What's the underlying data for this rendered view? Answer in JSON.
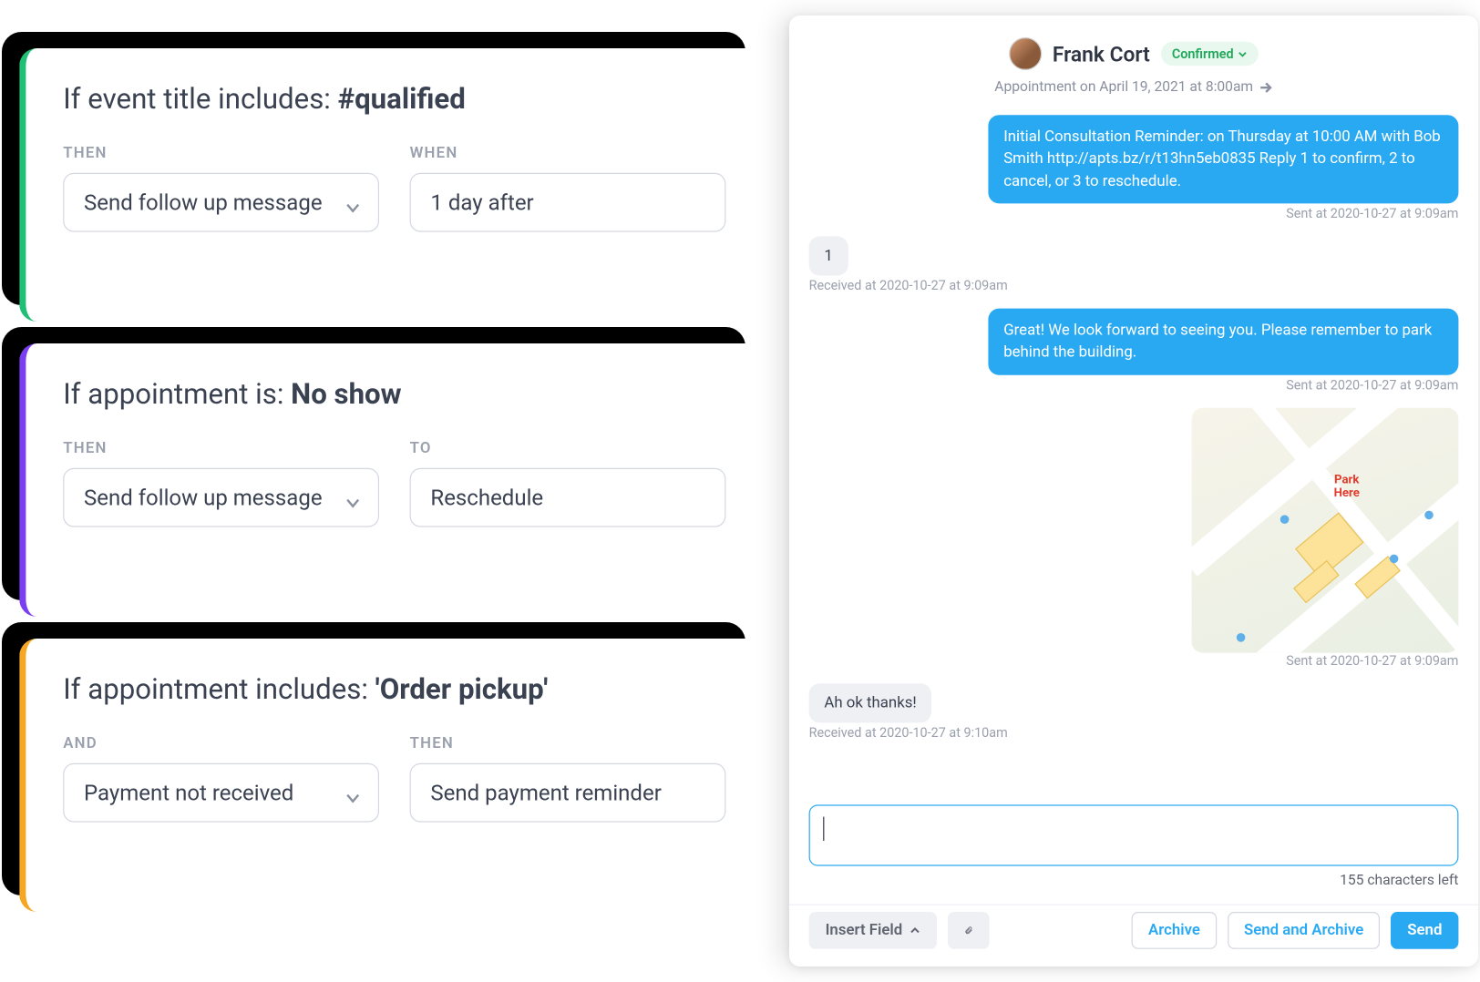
{
  "rules": [
    {
      "title_prefix": "If event title includes: ",
      "title_bold": "#qualified",
      "label1": "THEN",
      "value1": "Send follow up message",
      "label2": "WHEN",
      "value2": "1 day after"
    },
    {
      "title_prefix": "If appointment is: ",
      "title_bold": "No show",
      "label1": "THEN",
      "value1": "Send follow up message",
      "label2": "TO",
      "value2": "Reschedule"
    },
    {
      "title_prefix": "If appointment includes: ",
      "title_bold": "'Order pickup'",
      "label1": "AND",
      "value1": "Payment not received",
      "label2": "THEN",
      "value2": "Send payment reminder"
    }
  ],
  "chat": {
    "contact": "Frank Cort",
    "status": "Confirmed",
    "appt": "Appointment on April 19, 2021 at  8:00am",
    "messages": [
      {
        "side": "right",
        "type": "text",
        "text": "Initial Consultation Reminder: on Thursday at 10:00 AM with Bob Smith http://apts.bz/r/t13hn5eb0835 Reply 1 to confirm, 2 to cancel, or 3 to reschedule.",
        "meta": "Sent at 2020-10-27 at 9:09am"
      },
      {
        "side": "left",
        "type": "text",
        "text": "1",
        "meta": "Received at 2020-10-27 at 9:09am"
      },
      {
        "side": "right",
        "type": "text",
        "text": "Great! We look forward to seeing you. Please remember to park behind the building.",
        "meta": "Sent at 2020-10-27 at 9:09am"
      },
      {
        "side": "right",
        "type": "map",
        "label": "Park Here",
        "meta": "Sent at 2020-10-27 at 9:09am"
      },
      {
        "side": "left",
        "type": "text",
        "text": "Ah ok thanks!",
        "meta": "Received at 2020-10-27 at 9:10am"
      }
    ],
    "compose": {
      "chars_left": "155 characters left",
      "insert_field": "Insert Field",
      "archive": "Archive",
      "send_archive": "Send and Archive",
      "send": "Send"
    }
  }
}
